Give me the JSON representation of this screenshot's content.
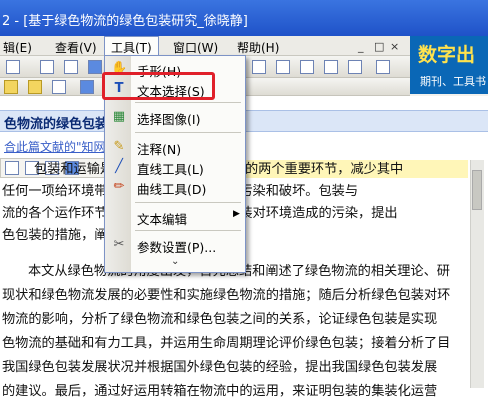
{
  "window": {
    "title_prefix": "2 - ",
    "title": "[基于绿色物流的绿色包装研究_徐晓静]"
  },
  "menu": {
    "edit": "辑(E)",
    "view": "查看(V)",
    "tools": "工具(T)",
    "window": "窗口(W)",
    "help": "帮助(H)"
  },
  "window_controls": {
    "minimize": "_",
    "restore": "□",
    "close": "×"
  },
  "banner": {
    "headline": "数字出",
    "subline": "期刊、工具书"
  },
  "document": {
    "heading": "色物流的绿色包装",
    "link": "合此篇文献的\"知网节\"",
    "lines": [
      "包装和运输是物流中对环境造成污染的两个重要环节，减少其中",
      "任何一项给环境带来的污染对环境带来的污染和破坏。包装与",
      "流的各个运作环节，绿色物流中分析了包装对环境造成的污染，提出",
      "色包装的措施，阐述了绿色包装的目标。",
      "本文从绿色物流的角度出发，首先总结和阐述了绿色物流的相关理论、研",
      "现状和绿色物流发展的必要性和实施绿色物流的措施；随后分析绿色包装对环",
      "物流的影响，分析了绿色物流和绿色包装之间的关系，论证绿色包装是实现",
      "色物流的基础和有力工具，并运用生命周期理论评价绿色包装；接着分析了目",
      "我国绿色包装发展状况并根据国外绿色包装的经验，提出我国绿色包装发展",
      "的建议。最后，通过好运用转箱在物流中的运用，来证明包装的集装化运营"
    ]
  },
  "tools_menu": {
    "items": [
      {
        "icon": "hand-icon",
        "glyph": "✋",
        "label": "手形(H)"
      },
      {
        "icon": "text-select-icon",
        "glyph": "T",
        "label": "文本选择(S)"
      },
      {
        "icon": "image-select-icon",
        "glyph": "▦",
        "label": "选择图像(I)"
      },
      {
        "icon": "note-icon",
        "glyph": "✎",
        "label": "注释(N)"
      },
      {
        "icon": "line-tool-icon",
        "glyph": "╱",
        "label": "直线工具(L)"
      },
      {
        "icon": "curve-tool-icon",
        "glyph": "✏",
        "label": "曲线工具(D)"
      },
      {
        "icon": "",
        "glyph": "",
        "label": "文本编辑"
      },
      {
        "icon": "settings-tools-icon",
        "glyph": "✂",
        "label": "参数设置(P)..."
      }
    ],
    "more": "⌄"
  },
  "colors": {
    "highlight": "#e0202a",
    "titlebar": "#2a5fd0",
    "banner": "#0a67b6"
  }
}
